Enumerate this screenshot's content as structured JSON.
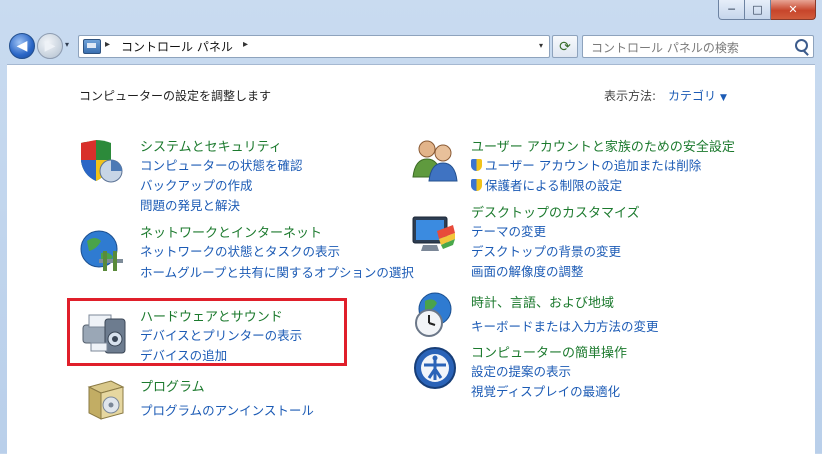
{
  "window": {
    "min_label": "─",
    "max_label": "□",
    "close_label": "✕"
  },
  "nav": {
    "back_glyph": "◀",
    "forward_glyph": "▶",
    "history_glyph": "▾",
    "address_crumb": "コントロール パネル",
    "address_sep": "▸",
    "address_dropdown_glyph": "▾",
    "refresh_glyph": "⟳",
    "search_placeholder": "コントロール パネルの検索"
  },
  "header": {
    "title": "コンピューターの設定を調整します",
    "view_by_label": "表示方法:",
    "view_by_value": "カテゴリ",
    "view_by_arrow": "▼"
  },
  "categories": {
    "system": {
      "title": "システムとセキュリティ",
      "links": [
        "コンピューターの状態を確認",
        "バックアップの作成",
        "問題の発見と解決"
      ]
    },
    "network": {
      "title": "ネットワークとインターネット",
      "links": [
        "ネットワークの状態とタスクの表示",
        "ホームグループと共有に関するオプションの選択"
      ]
    },
    "hardware": {
      "title": "ハードウェアとサウンド",
      "links": [
        "デバイスとプリンターの表示",
        "デバイスの追加"
      ]
    },
    "programs": {
      "title": "プログラム",
      "links": [
        "プログラムのアンインストール"
      ]
    },
    "users": {
      "title": "ユーザー アカウントと家族のための安全設定",
      "links": [
        "ユーザー アカウントの追加または削除",
        "保護者による制限の設定"
      ]
    },
    "appearance": {
      "title": "デスクトップのカスタマイズ",
      "links": [
        "テーマの変更",
        "デスクトップの背景の変更",
        "画面の解像度の調整"
      ]
    },
    "clock": {
      "title": "時計、言語、および地域",
      "links": [
        "キーボードまたは入力方法の変更"
      ]
    },
    "ease": {
      "title": "コンピューターの簡単操作",
      "links": [
        "設定の提案の表示",
        "視覚ディスプレイの最適化"
      ]
    }
  },
  "colors": {
    "category_title": "#1c7a2e",
    "link": "#1c5bb5",
    "highlight_box": "#e01f2a"
  }
}
